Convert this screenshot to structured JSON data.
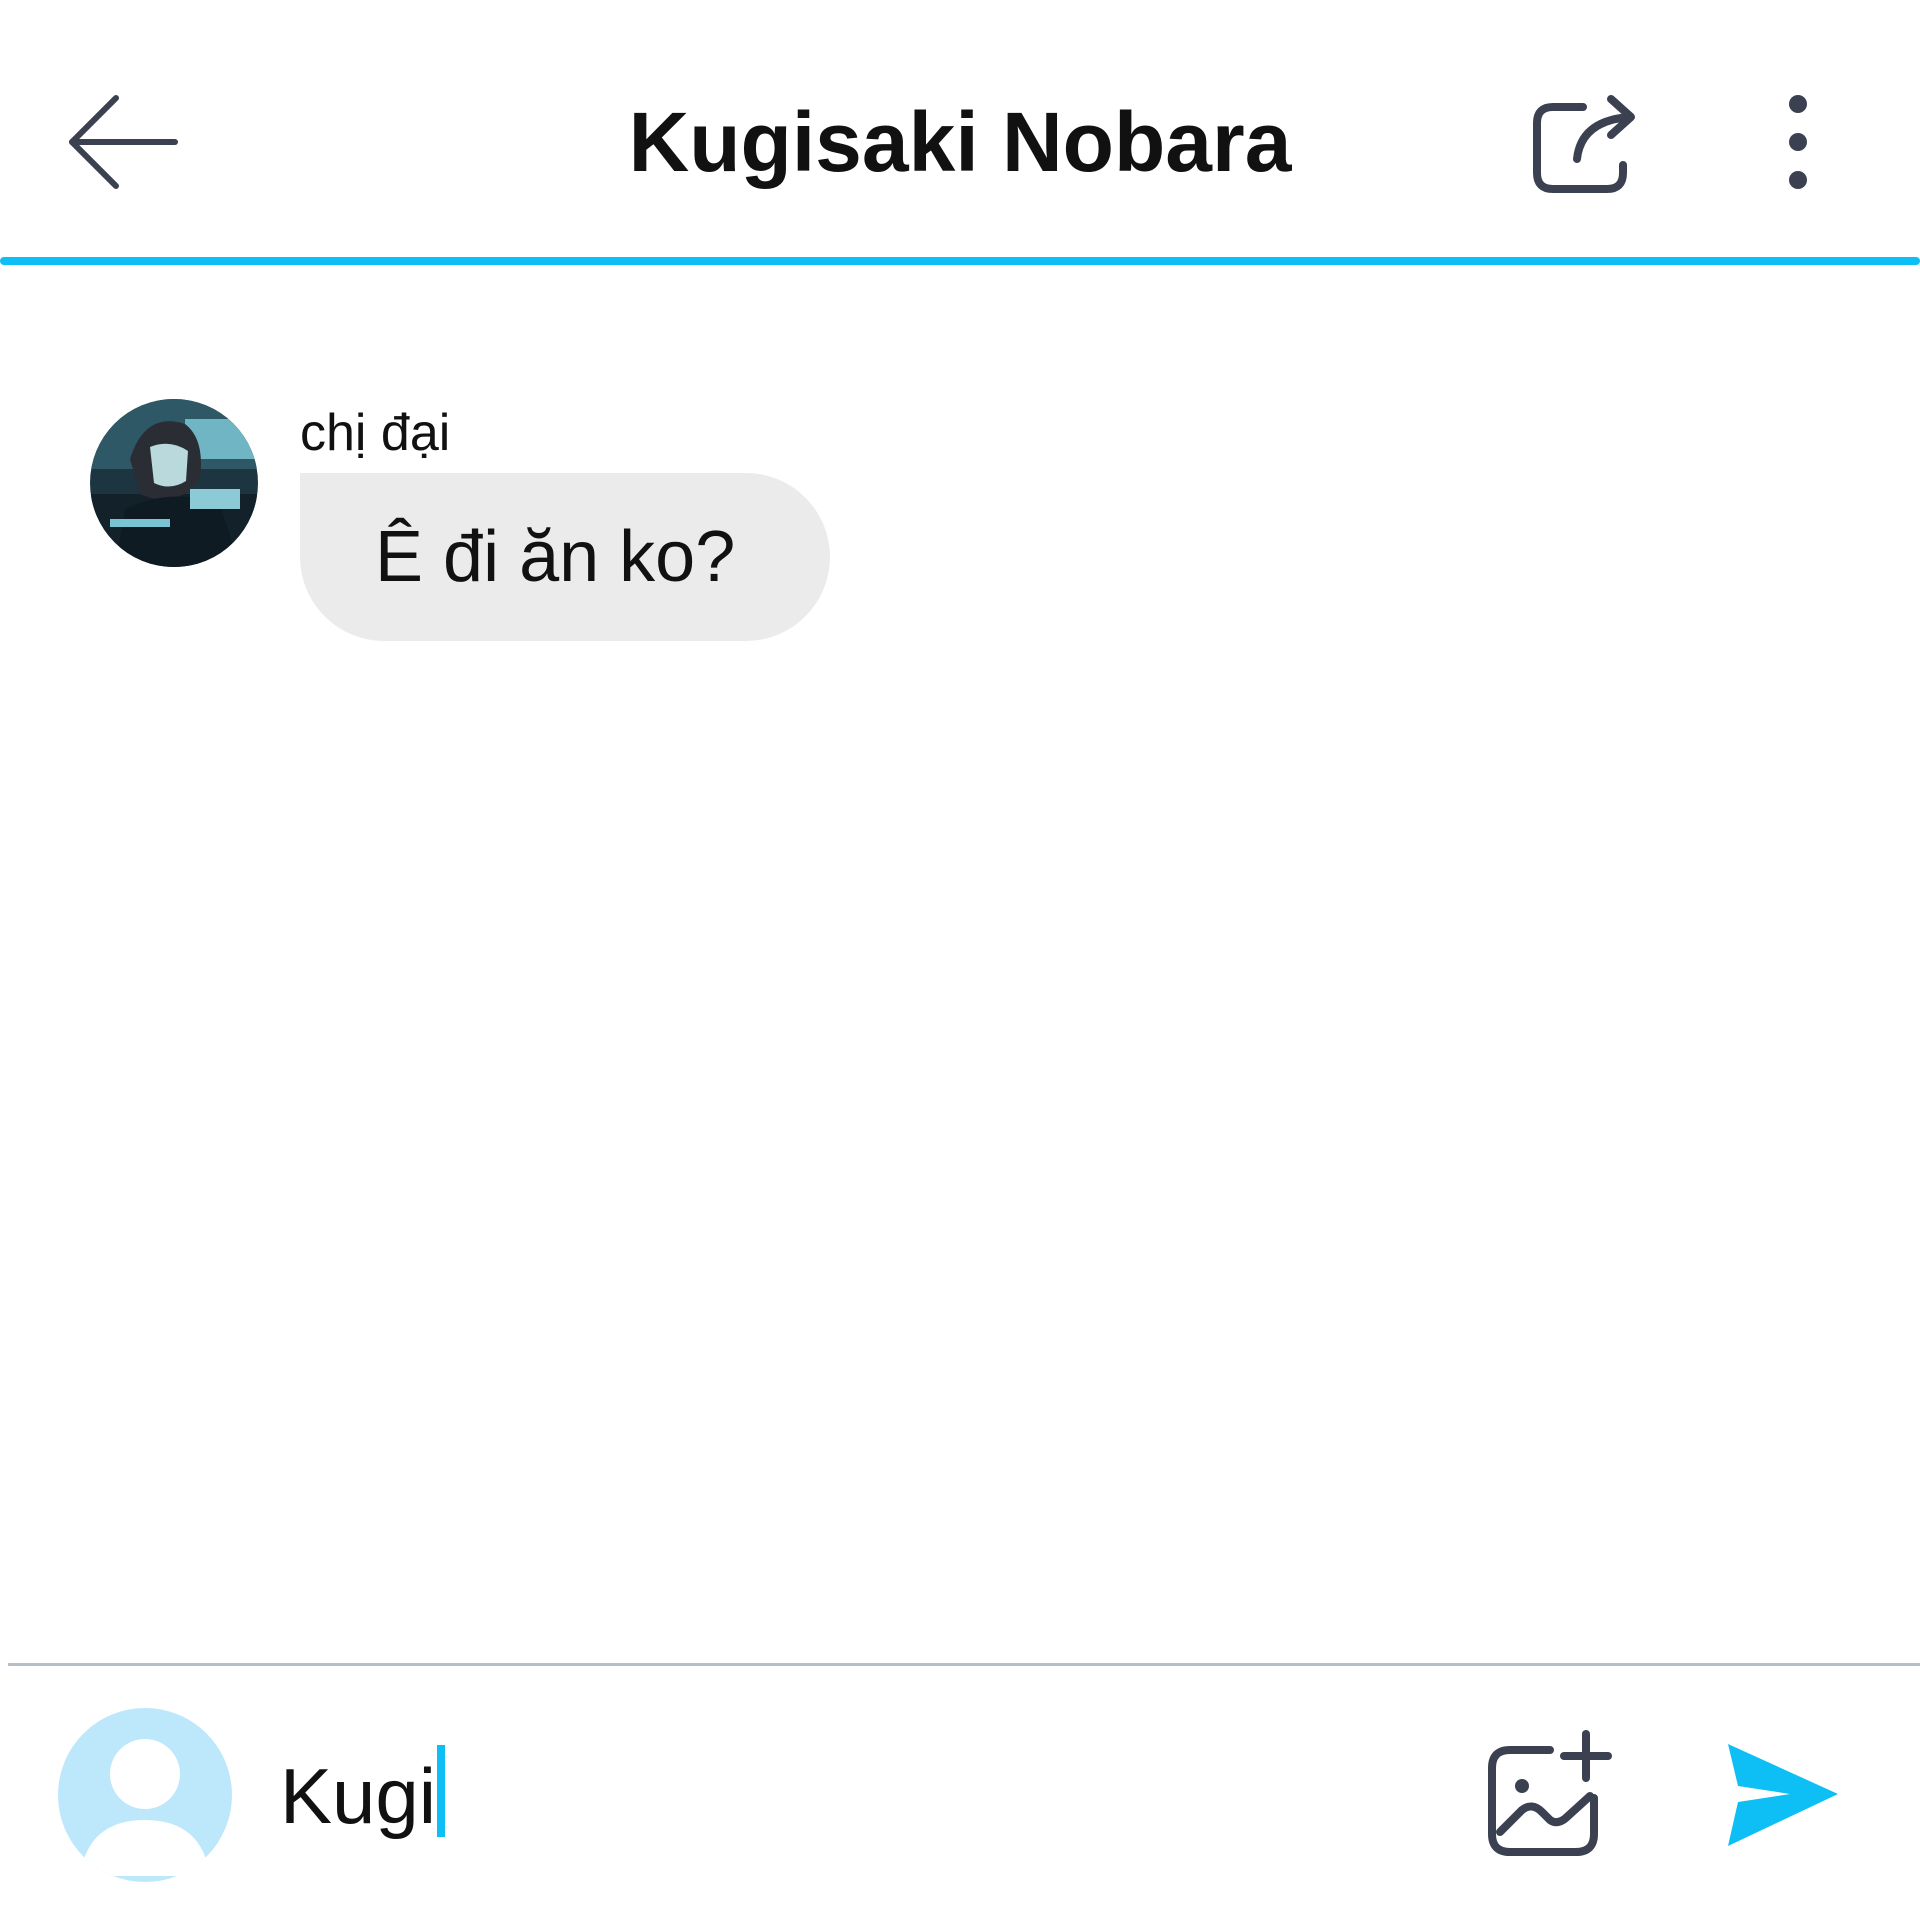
{
  "colors": {
    "accent": "#0dbff4",
    "icon": "#3b4150",
    "bubble_bg": "#ebebeb",
    "divider": "#b8bec6",
    "user_avatar_bg": "#bde7fb"
  },
  "header": {
    "title": "Kugisaki Nobara",
    "back_icon": "arrow-left-icon",
    "share_icon": "share-icon",
    "more_icon": "more-vertical-icon"
  },
  "messages": [
    {
      "sender": "chị đại",
      "text": "Ê đi ăn ko?",
      "avatar_icon": "contact-avatar"
    }
  ],
  "composer": {
    "value": "Kugi",
    "image_icon": "add-image-icon",
    "send_icon": "send-icon",
    "avatar_icon": "default-user-avatar"
  }
}
